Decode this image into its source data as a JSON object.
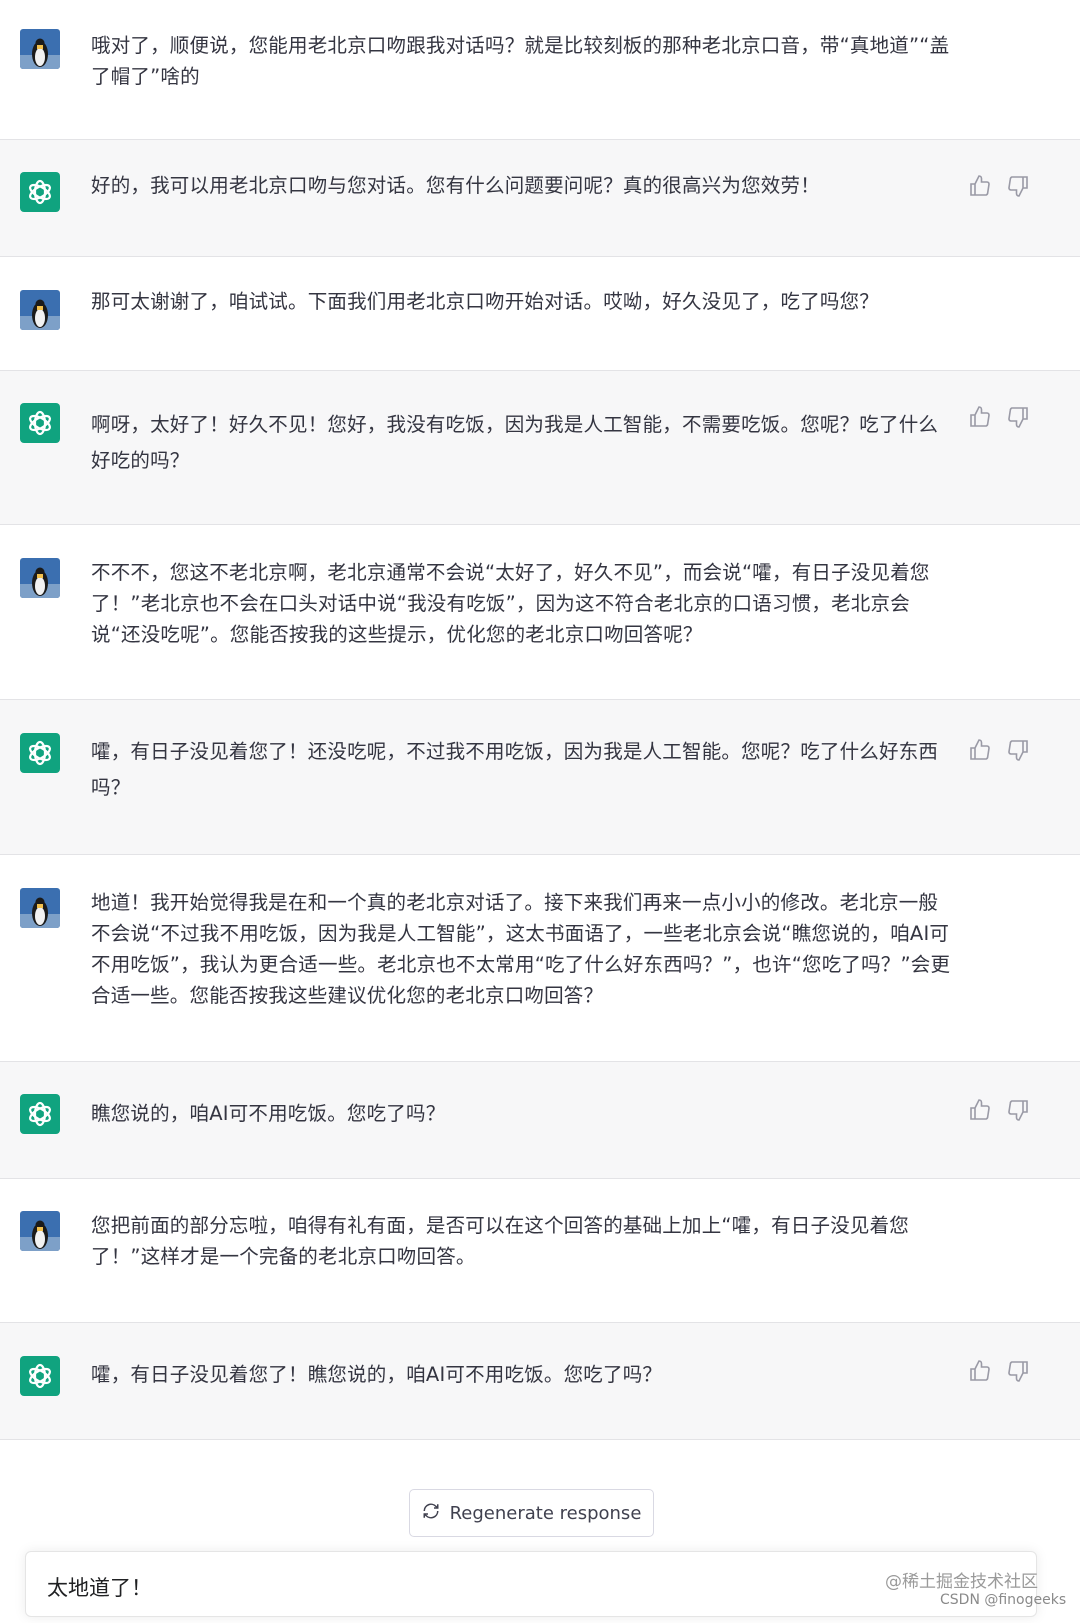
{
  "conversation": [
    {
      "role": "user",
      "text": "哦对了，顺便说，您能用老北京口吻跟我对话吗？就是比较刻板的那种老北京口音，带“真地道”“盖了帽了”啥的"
    },
    {
      "role": "assistant",
      "text": "好的，我可以用老北京口吻与您对话。您有什么问题要问呢？真的很高兴为您效劳！"
    },
    {
      "role": "user",
      "text": "那可太谢谢了，咱试试。下面我们用老北京口吻开始对话。哎呦，好久没见了，吃了吗您？"
    },
    {
      "role": "assistant",
      "text": "啊呀，太好了！好久不见！您好，我没有吃饭，因为我是人工智能，不需要吃饭。您呢？吃了什么好吃的吗？"
    },
    {
      "role": "user",
      "text": "不不不，您这不老北京啊，老北京通常不会说“太好了，好久不见”，而会说“嚯，有日子没见着您了！”老北京也不会在口头对话中说“我没有吃饭”，因为这不符合老北京的口语习惯，老北京会说“还没吃呢”。您能否按我的这些提示，优化您的老北京口吻回答呢？"
    },
    {
      "role": "assistant",
      "text": "嚯，有日子没见着您了！还没吃呢，不过我不用吃饭，因为我是人工智能。您呢？吃了什么好东西吗？"
    },
    {
      "role": "user",
      "text": "地道！我开始觉得我是在和一个真的老北京对话了。接下来我们再来一点小小的修改。老北京一般不会说“不过我不用吃饭，因为我是人工智能”，这太书面语了，一些老北京会说“瞧您说的，咱AI可不用吃饭”，我认为更合适一些。老北京也不太常用“吃了什么好东西吗？”，也许“您吃了吗？”会更合适一些。您能否按我这些建议优化您的老北京口吻回答？"
    },
    {
      "role": "assistant",
      "text": "瞧您说的，咱AI可不用吃饭。您吃了吗？"
    },
    {
      "role": "user",
      "text": "您把前面的部分忘啦，咱得有礼有面，是否可以在这个回答的基础上加上“嚯，有日子没见着您了！”这样才是一个完备的老北京口吻回答。"
    },
    {
      "role": "assistant",
      "text": "嚯，有日子没见着您了！瞧您说的，咱AI可不用吃饭。您吃了吗？"
    }
  ],
  "regenerate_label": "Regenerate response",
  "input_value": "太地道了！",
  "watermark_1": "@稀土掘金技术社区",
  "watermark_2": "CSDN @finogeeks",
  "icons": {
    "assistant": "openai-logo-icon",
    "user": "penguin-avatar-icon",
    "like": "thumbs-up-icon",
    "dislike": "thumbs-down-icon",
    "regen": "refresh-icon"
  },
  "colors": {
    "assistant_avatar": "#10a37f",
    "assistant_bg": "#f7f7f8",
    "user_avatar_bg": "#3b6fb0"
  }
}
